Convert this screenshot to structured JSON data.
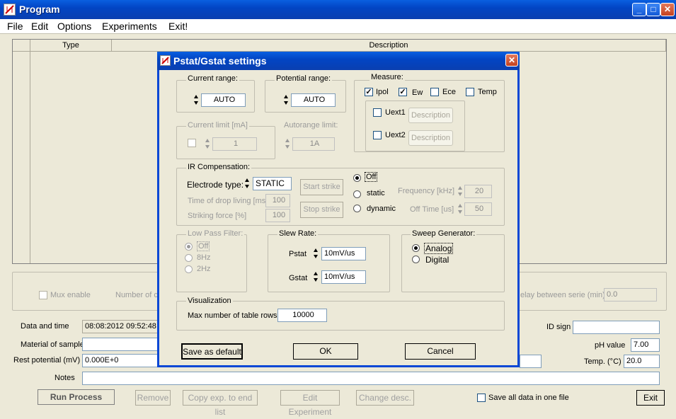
{
  "window": {
    "title": "Program",
    "min": "_",
    "max": "□",
    "close": "✕"
  },
  "menu": [
    "File",
    "Edit",
    "Options",
    "Experiments",
    "Exit!"
  ],
  "grid": {
    "columns": [
      "Type",
      "Description"
    ]
  },
  "mux": {
    "label": "Mux enable",
    "number_label": "Number of c",
    "delay_label": "elay between serie (min)",
    "delay_value": "0.0"
  },
  "info": {
    "date_label": "Data and time",
    "date_value": "08:08:2012  09:52:48",
    "material_label": "Material of sample",
    "rest_label": "Rest potential (mV)",
    "rest_value": "0.000E+0",
    "notes_label": "Notes",
    "id_label": "ID sign",
    "ph_label": "pH value",
    "ph_value": "7.00",
    "temp_label": "Temp. (°C)",
    "temp_value": "20.0"
  },
  "bottom": {
    "run": "Run Process",
    "remove": "Remove",
    "copy": "Copy exp. to end list",
    "edit": "Edit Experiment",
    "change": "Change desc.",
    "saveall": "Save all data in one file",
    "exit": "Exit"
  },
  "dialog": {
    "title": "Pstat/Gstat settings",
    "current_range": {
      "label": "Current range:",
      "value": "AUTO"
    },
    "potential_range": {
      "label": "Potential range:",
      "value": "AUTO"
    },
    "measure": {
      "label": "Measure:",
      "ipol": "Ipol",
      "ew": "Ew",
      "ece": "Ece",
      "temp": "Temp",
      "uext1": "Uext1",
      "uext2": "Uext2",
      "desc": "Description"
    },
    "current_limit": {
      "label": "Current limit [mA]",
      "value": "1"
    },
    "autorange": {
      "label": "Autorange limit:",
      "value": "1A"
    },
    "ir": {
      "label": "IR Compensation:",
      "electrode_label": "Electrode type:",
      "electrode_value": "STATIC",
      "drop_label": "Time of drop living [ms]",
      "drop_value": "100",
      "strike_label": "Striking force [%]",
      "strike_value": "100",
      "start": "Start strike",
      "stop": "Stop strike",
      "off": "Off",
      "static": "static",
      "dynamic": "dynamic",
      "freq_label": "Frequency [kHz]",
      "freq_value": "20",
      "offtime_label": "Off Time [us]",
      "offtime_value": "50"
    },
    "lpf": {
      "label": "Low Pass Filter:",
      "off": "Off",
      "f8": "8Hz",
      "f2": "2Hz"
    },
    "slew": {
      "label": "Slew Rate:",
      "pstat_label": "Pstat",
      "pstat_value": "10mV/us",
      "gstat_label": "Gstat",
      "gstat_value": "10mV/us"
    },
    "sweep": {
      "label": "Sweep Generator:",
      "analog": "Analog",
      "digital": "Digital"
    },
    "vis": {
      "label": "Visualization",
      "rows_label": "Max number of table rows",
      "rows_value": "10000"
    },
    "buttons": {
      "save": "Save as default",
      "ok": "OK",
      "cancel": "Cancel"
    }
  }
}
